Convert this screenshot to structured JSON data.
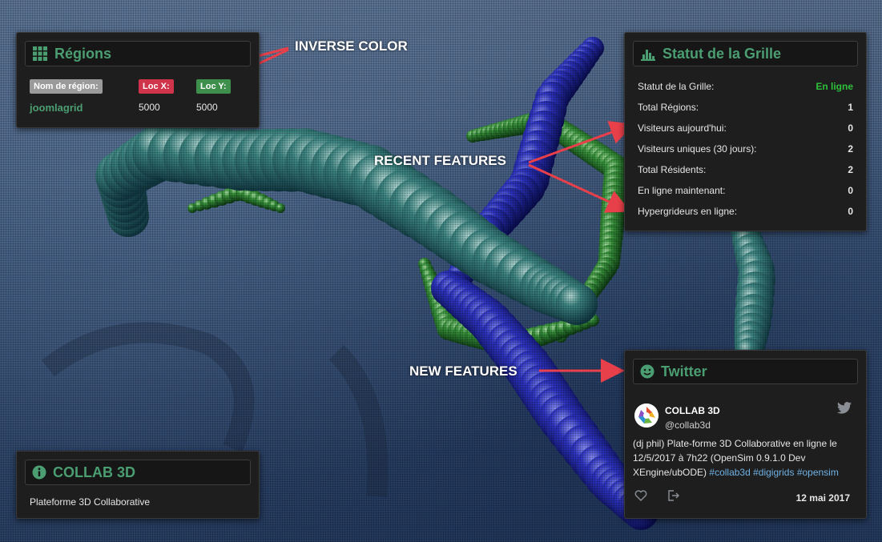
{
  "regions_panel": {
    "title": "Régions",
    "headers": [
      "Nom de région:",
      "Loc X:",
      "Loc Y:"
    ],
    "row": {
      "name": "joomlagrid",
      "loc_x": "5000",
      "loc_y": "5000"
    }
  },
  "status_panel": {
    "title": "Statut de la Grille",
    "rows": [
      {
        "label": "Statut de la Grille:",
        "value": "En ligne"
      },
      {
        "label": "Total Régions:",
        "value": "1"
      },
      {
        "label": "Visiteurs aujourd'hui:",
        "value": "0"
      },
      {
        "label": "Visiteurs uniques (30 jours):",
        "value": "2"
      },
      {
        "label": "Total Résidents:",
        "value": "2"
      },
      {
        "label": "En ligne maintenant:",
        "value": "0"
      },
      {
        "label": "Hypergrideurs en ligne:",
        "value": "0"
      }
    ]
  },
  "twitter_panel": {
    "title": "Twitter",
    "tweet": {
      "name": "COLLAB 3D",
      "handle": "@collab3d",
      "text": "(dj phil) Plate-forme 3D Collaborative en ligne le 12/5/2017 à 7h22 (OpenSim 0.9.1.0 Dev XEngine/ubODE)",
      "hashtags": "#collab3d #digigrids #opensim",
      "date": "12 mai 2017"
    }
  },
  "collab_panel": {
    "title": "COLLAB 3D",
    "text": "Plateforme 3D Collaborative"
  },
  "annotations": {
    "inverse_color": "INVERSE COLOR",
    "recent_features": "RECENT FEATURES",
    "new_features": "NEW FEATURES"
  },
  "colors": {
    "accent_green": "#4b9e72",
    "online_green": "#2fbf3a",
    "tag_red": "#d0344a",
    "tag_green": "#3e8f4c",
    "tag_grey": "#9a9a9a",
    "hashtag_blue": "#6fb1e4",
    "arrow_red": "#e8404a"
  },
  "icons": [
    "grid-icon",
    "bar-chart-icon",
    "smile-icon",
    "info-icon",
    "twitter-bird-icon",
    "heart-icon",
    "share-icon"
  ]
}
